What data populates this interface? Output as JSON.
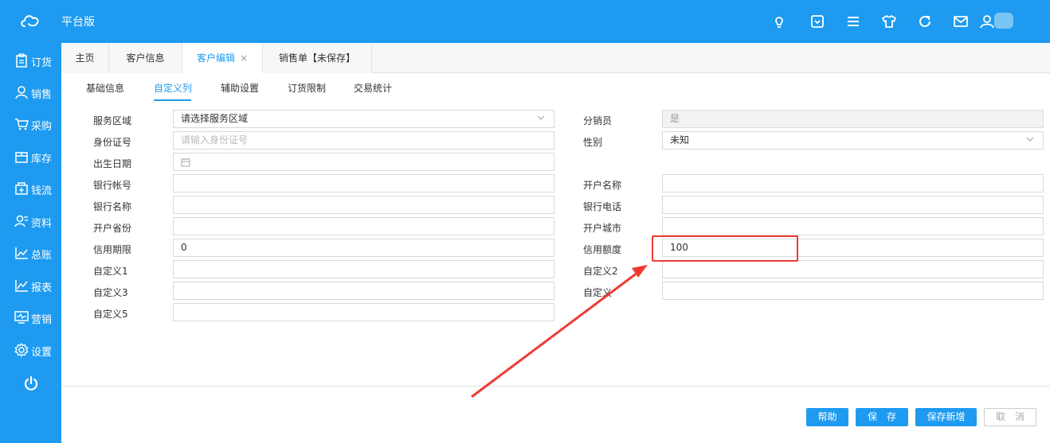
{
  "app": {
    "title": "平台版"
  },
  "topbar": {
    "icons": [
      "bulb-icon",
      "check-square-icon",
      "menu-icon",
      "shirt-icon",
      "refresh-icon",
      "mail-icon",
      "user-icon"
    ]
  },
  "sidebar": {
    "items": [
      {
        "label": "订货",
        "icon": "clipboard-icon"
      },
      {
        "label": "销售",
        "icon": "person-icon"
      },
      {
        "label": "采购",
        "icon": "cart-icon"
      },
      {
        "label": "库存",
        "icon": "box-icon"
      },
      {
        "label": "钱流",
        "icon": "wallet-icon"
      },
      {
        "label": "资料",
        "icon": "contacts-icon"
      },
      {
        "label": "总账",
        "icon": "chart-icon"
      },
      {
        "label": "报表",
        "icon": "report-icon"
      },
      {
        "label": "营销",
        "icon": "monitor-icon"
      },
      {
        "label": "设置",
        "icon": "gear-icon"
      }
    ]
  },
  "tabs": [
    {
      "label": "主页"
    },
    {
      "label": "客户信息"
    },
    {
      "label": "客户编辑",
      "close": "×"
    },
    {
      "label": "销售单【未保存】"
    }
  ],
  "subtabs": [
    {
      "label": "基础信息"
    },
    {
      "label": "自定义列"
    },
    {
      "label": "辅助设置"
    },
    {
      "label": "订货限制"
    },
    {
      "label": "交易统计"
    }
  ],
  "form": {
    "left": [
      {
        "label": "服务区域",
        "value": "请选择服务区域"
      },
      {
        "label": "身份证号",
        "placeholder": "请输入身份证号"
      },
      {
        "label": "出生日期",
        "value": ""
      },
      {
        "label": "银行帐号",
        "value": ""
      },
      {
        "label": "银行名称",
        "value": ""
      },
      {
        "label": "开户省份",
        "value": ""
      },
      {
        "label": "信用期限",
        "value": "0"
      },
      {
        "label": "自定义1",
        "value": ""
      },
      {
        "label": "自定义3",
        "value": ""
      },
      {
        "label": "自定义5",
        "value": ""
      }
    ],
    "right": [
      {
        "label": "分销员",
        "value": "是"
      },
      {
        "label": "性别",
        "value": "未知"
      },
      {
        "label": "开户名称",
        "value": ""
      },
      {
        "label": "银行电话",
        "value": ""
      },
      {
        "label": "开户城市",
        "value": ""
      },
      {
        "label": "信用额度",
        "value": "100"
      },
      {
        "label": "自定义2",
        "value": ""
      },
      {
        "label": "自定义",
        "value": ""
      }
    ]
  },
  "buttons": {
    "help": "帮助",
    "save": "保　存",
    "save_new": "保存新增",
    "cancel": "取　消"
  },
  "colors": {
    "brand": "#1e9bf0",
    "annotation": "#f03a32"
  }
}
